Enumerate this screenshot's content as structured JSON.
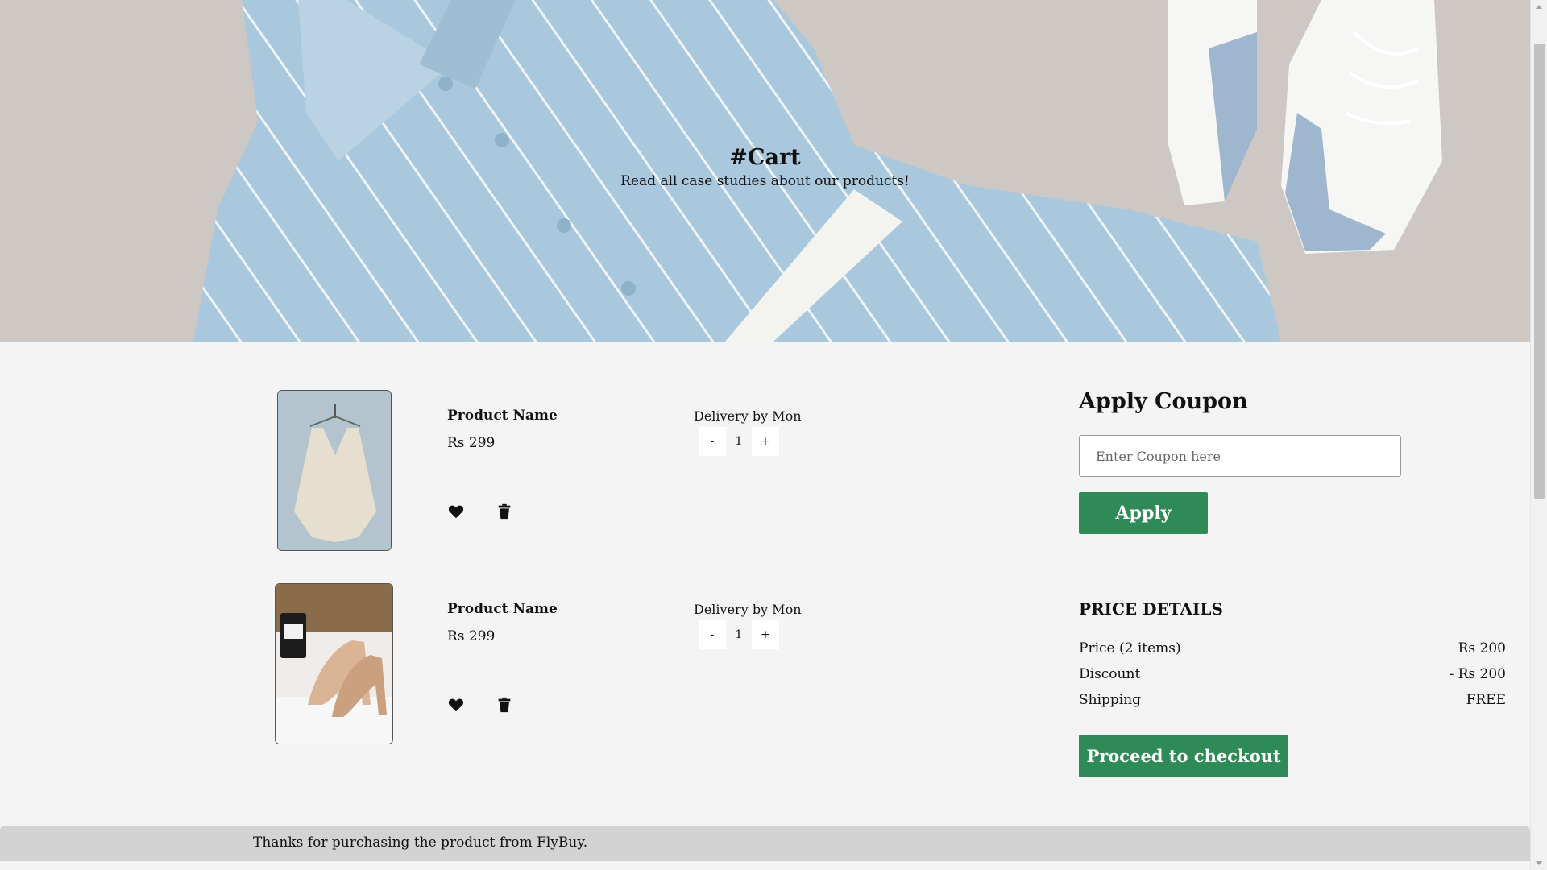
{
  "hero": {
    "title": "#Cart",
    "subtitle": "Read all case studies about our products!"
  },
  "cart": {
    "items": [
      {
        "name": "Product Name",
        "price": "Rs 299",
        "delivery": "Delivery by Mon",
        "qty_minus": "-",
        "quantity": "1",
        "qty_plus": "+",
        "image": "knit-poncho-on-hanger"
      },
      {
        "name": "Product Name",
        "price": "Rs 299",
        "delivery": "Delivery by Mon",
        "qty_minus": "-",
        "quantity": "1",
        "qty_plus": "+",
        "image": "glitter-heels"
      }
    ],
    "icons": {
      "wishlist": "heart-icon",
      "remove": "trash-icon"
    }
  },
  "coupon": {
    "title": "Apply Coupon",
    "placeholder": "Enter Coupon here",
    "apply_label": "Apply"
  },
  "price_details": {
    "title": "PRICE DETAILS",
    "rows": [
      {
        "label": "Price (2 items)",
        "value": "Rs 200"
      },
      {
        "label": "Discount",
        "value": "- Rs 200"
      },
      {
        "label": "Shipping",
        "value": "FREE"
      }
    ],
    "checkout_label": "Proceed to checkout"
  },
  "footer": {
    "text": "Thanks for purchasing the product from FlyBuy."
  },
  "colors": {
    "accent": "#2e8b57",
    "page_bg": "#f4f4f4",
    "footer_bg": "#d3d3d3"
  }
}
